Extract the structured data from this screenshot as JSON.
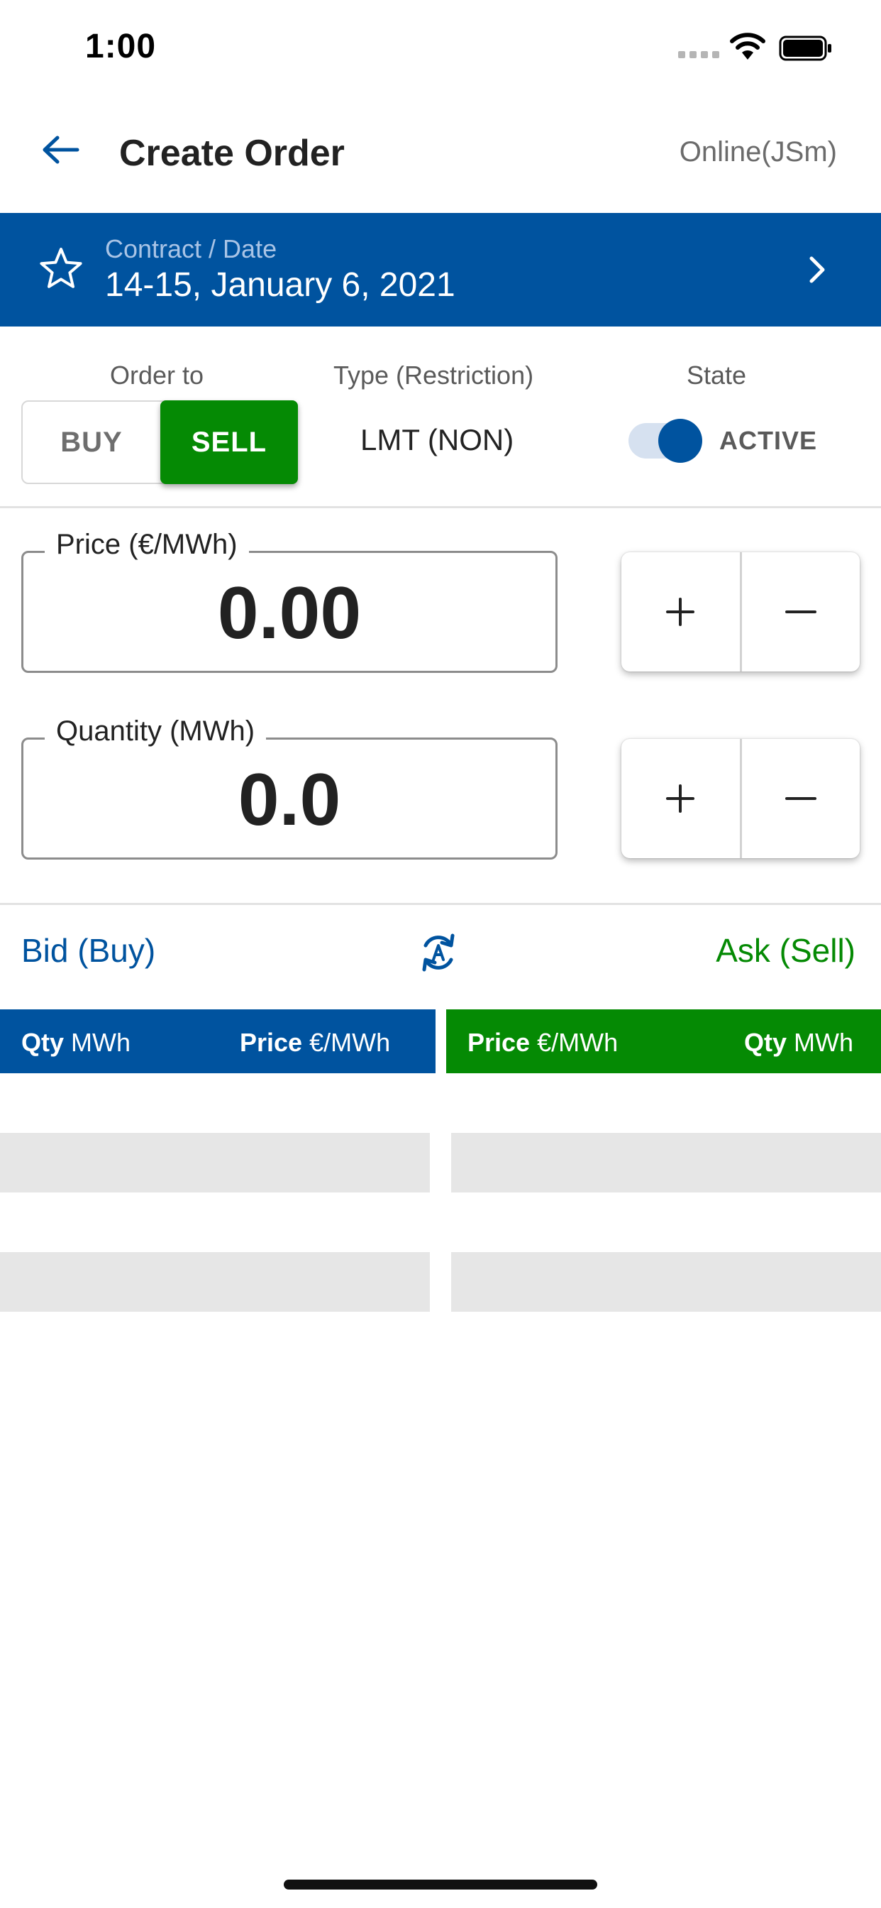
{
  "status_bar": {
    "time": "1:00"
  },
  "header": {
    "title": "Create Order",
    "connection": "Online(JSm)"
  },
  "contract": {
    "label": "Contract / Date",
    "value": "14-15, January 6, 2021"
  },
  "order_config": {
    "order_to_label": "Order to",
    "buy_label": "BUY",
    "sell_label": "SELL",
    "selected_side": "SELL",
    "type_label": "Type (Restriction)",
    "type_value": "LMT (NON)",
    "state_label": "State",
    "state_value": "ACTIVE",
    "state_on": true
  },
  "price": {
    "label": "Price (€/MWh)",
    "value": "0.00"
  },
  "quantity": {
    "label": "Quantity (MWh)",
    "value": "0.0"
  },
  "order_book": {
    "bid_title": "Bid (Buy)",
    "ask_title": "Ask (Sell)",
    "bid_columns": [
      {
        "bold": "Qty",
        "unit": "MWh"
      },
      {
        "bold": "Price",
        "unit": "€/MWh"
      }
    ],
    "ask_columns": [
      {
        "bold": "Price",
        "unit": "€/MWh"
      },
      {
        "bold": "Qty",
        "unit": "MWh"
      }
    ]
  },
  "colors": {
    "primary_blue": "#00539f",
    "sell_green": "#058a04"
  }
}
